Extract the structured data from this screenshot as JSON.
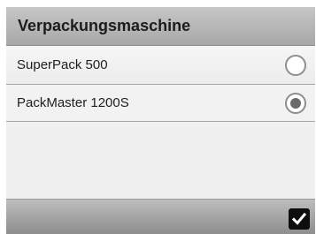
{
  "dialog": {
    "title": "Verpackungsmaschine"
  },
  "options": [
    {
      "label": "SuperPack 500",
      "selected": false
    },
    {
      "label": "PackMaster 1200S",
      "selected": true
    }
  ],
  "footer": {
    "confirm_icon": "checkmark-icon"
  }
}
